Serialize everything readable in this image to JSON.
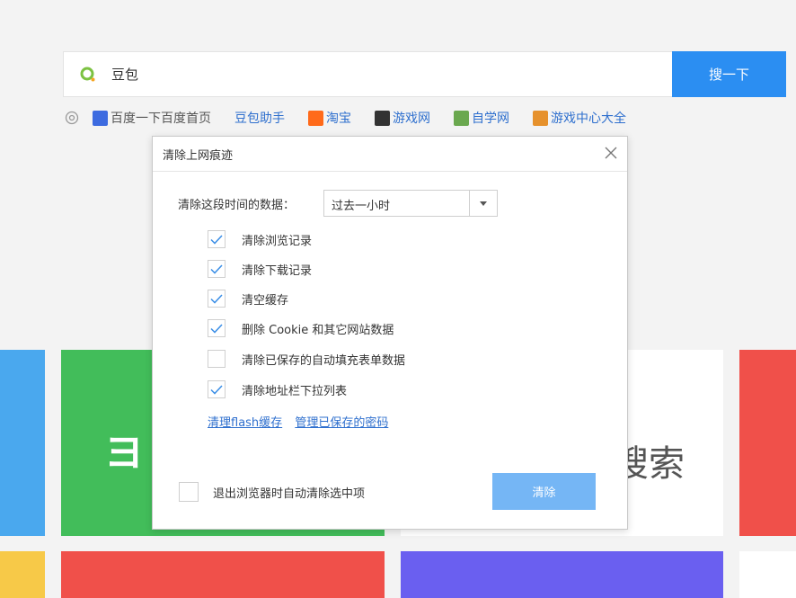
{
  "search": {
    "query": "豆包",
    "button_label": "搜一下"
  },
  "quick_links": [
    {
      "label": "百度一下百度首页",
      "icon": "baidu-icon",
      "color": "#3d6be0"
    },
    {
      "label": "豆包助手",
      "icon": "",
      "color": ""
    },
    {
      "label": "淘宝",
      "icon": "taobao-icon",
      "color": "#ff6a1a"
    },
    {
      "label": "游戏网",
      "icon": "game-site-icon",
      "color": "#333333"
    },
    {
      "label": "自学网",
      "icon": "self-study-icon",
      "color": "#6aa84f"
    },
    {
      "label": "游戏中心大全",
      "icon": "game-center-icon",
      "color": "#e6912c"
    }
  ],
  "tiles": {
    "green_text": "ヨ",
    "white_text": "搜索"
  },
  "dialog": {
    "title": "清除上网痕迹",
    "range_label": "清除这段时间的数据：",
    "range_value": "过去一小时",
    "options": [
      {
        "label": "清除浏览记录",
        "checked": true
      },
      {
        "label": "清除下载记录",
        "checked": true
      },
      {
        "label": "清空缓存",
        "checked": true
      },
      {
        "label": "删除 Cookie 和其它网站数据",
        "checked": true
      },
      {
        "label": "清除已保存的自动填充表单数据",
        "checked": false
      },
      {
        "label": "清除地址栏下拉列表",
        "checked": true
      }
    ],
    "link_flash": "清理flash缓存",
    "link_passwords": "管理已保存的密码",
    "auto_clear_label": "退出浏览器时自动清除选中项",
    "auto_clear_checked": false,
    "clear_button": "清除"
  },
  "colors": {
    "accent": "#2b8ef2",
    "clear_button": "#75b6f5",
    "link": "#2e6fce"
  }
}
